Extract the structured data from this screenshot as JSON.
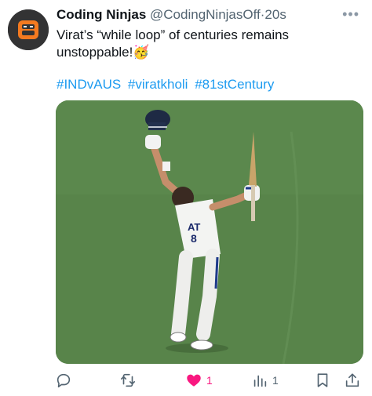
{
  "tweet": {
    "author_name": "Coding Ninjas",
    "handle": "@CodingNinjasOff",
    "separator": "·",
    "time": "20s",
    "text": "Virat’s “while loop” of centuries remains unstoppable!🥳",
    "hashtags": [
      "#INDvAUS",
      "#viratkholi",
      "#81stCentury"
    ]
  },
  "photo": {
    "jersey_text": "AT",
    "jersey_number": "8"
  },
  "actions": {
    "reply_count": "",
    "retweet_count": "",
    "like_count": "1",
    "views_count": "1"
  },
  "colors": {
    "accent": "#1d9bf0",
    "like": "#f91880",
    "muted": "#536471",
    "avatar_bg": "#333334",
    "avatar_logo": "#f47a20"
  }
}
